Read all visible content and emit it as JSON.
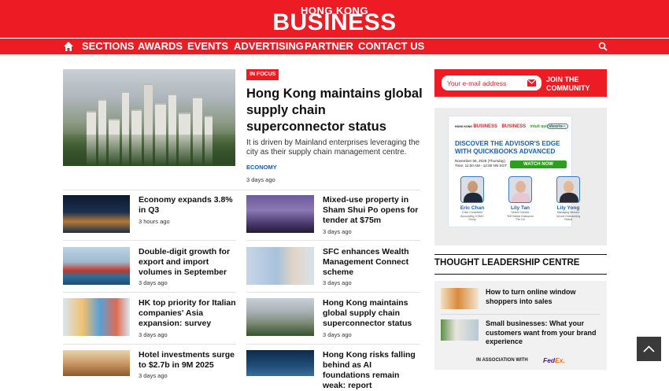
{
  "header": {
    "logo_small": "HONG KONG",
    "logo_big": "BUSINESS",
    "brand_color": "#ec1b24"
  },
  "nav": {
    "home_icon": "home-icon",
    "items": [
      "SECTIONS",
      "AWARDS",
      "EVENTS",
      "ADVERTISING",
      "PARTNER",
      "CONTACT US"
    ],
    "search_icon": "search-icon"
  },
  "hero": {
    "badge": "IN FOCUS",
    "title": "Hong Kong maintains global supply chain superconnector status",
    "description": "It is driven by Mainland enterprises leveraging the city as their supply chain management centre.",
    "category": "ECONOMY",
    "date": "3 days ago"
  },
  "articles": [
    {
      "title": "Economy expands 3.8% in Q3",
      "date": "3 hours ago"
    },
    {
      "title": "Mixed-use property in Sham Shui Po opens for tender at $75m",
      "date": "3 days ago"
    },
    {
      "title": "Double-digit growth for export and import volumes in September",
      "date": "3 days ago"
    },
    {
      "title": "SFC enhances Wealth Management Connect scheme",
      "date": "3 days ago"
    },
    {
      "title": "HK top priority for Italian companies' Asia expansion: survey",
      "date": "3 days ago"
    },
    {
      "title": "Hong Kong maintains global supply chain superconnector status",
      "date": "3 days ago"
    },
    {
      "title": "Hotel investments surge to $2.7b in 9M 2025",
      "date": "3 days ago"
    },
    {
      "title": "Hong Kong risks falling behind as AI foundations remain weak: report",
      "date": "3 days ago"
    }
  ],
  "subscribe": {
    "placeholder": "Your e-mail address",
    "join_line1": "JOIN THE",
    "join_line2": "COMMUNITY"
  },
  "webinar": {
    "logo_hkb_small": "HONG KONG",
    "logo_hkb": "BUSINESS",
    "logo_hkb2": "BUSINESS",
    "logo_intuit": "intuit quickbooks",
    "tag": "WEBINAR",
    "title": "DISCOVER THE ADVISOR'S EDGE WITH QUICKBOOKS ADVANCED",
    "date_line1": "November 06, 2025 (Thursday)",
    "date_line2": "Time: 11:00 AM - 12:00 NN SGT",
    "cta": "WATCH NOW",
    "speakers": [
      {
        "name": "Eric Chan",
        "role1": "Chief Consultant",
        "role2": "Accounting, KGMC Group"
      },
      {
        "name": "Lily Tan",
        "role1": "Senior Director",
        "role2": "TeB Global Outsource Pte Ltd"
      },
      {
        "name": "Lily Yong",
        "role1": "Managing Director",
        "role2": "inCore Outsourcing Global"
      }
    ]
  },
  "thought_leadership": {
    "title": "THOUGHT LEADERSHIP CENTRE",
    "items": [
      {
        "title": "How to turn online window shoppers into sales"
      },
      {
        "title": "Small businesses: What your customers want from your brand experience"
      }
    ],
    "association": "IN ASSOCIATION WITH",
    "partner_fed": "Fed",
    "partner_ex": "Ex."
  },
  "scroll_top_icon": "chevron-up-icon"
}
